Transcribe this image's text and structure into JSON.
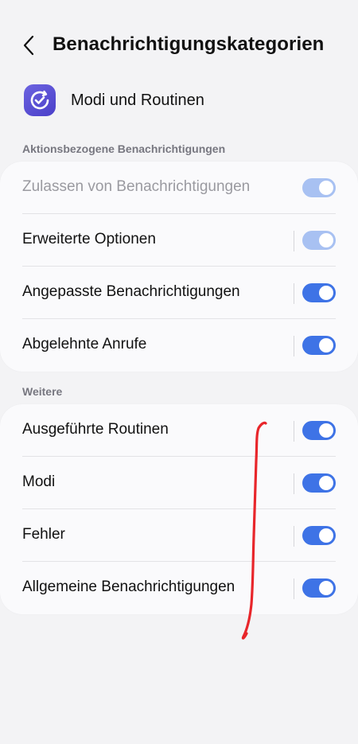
{
  "header": {
    "title": "Benachrichtigungskategorien"
  },
  "app": {
    "name": "Modi und Routinen",
    "icon": "routine-check-icon"
  },
  "sections": [
    {
      "label": "Aktionsbezogene Benachrichtigungen",
      "items": [
        {
          "label": "Zulassen von Benachrichtigungen",
          "enabled": false,
          "toggle_on": true
        },
        {
          "label": "Erweiterte Optionen",
          "enabled": true,
          "toggle_on": true,
          "toggle_dimmed": true
        },
        {
          "label": "Angepasste Benachrichtigungen",
          "enabled": true,
          "toggle_on": true
        },
        {
          "label": "Abgelehnte Anrufe",
          "enabled": true,
          "toggle_on": true
        }
      ]
    },
    {
      "label": "Weitere",
      "items": [
        {
          "label": "Ausgeführte Routinen",
          "enabled": true,
          "toggle_on": true
        },
        {
          "label": "Modi",
          "enabled": true,
          "toggle_on": true
        },
        {
          "label": "Fehler",
          "enabled": true,
          "toggle_on": true
        },
        {
          "label": "Allgemeine Benachrichtigungen",
          "enabled": true,
          "toggle_on": true
        }
      ]
    }
  ],
  "colors": {
    "accent": "#3e73e6",
    "accent_dimmed": "#a8c1f2",
    "annotation_stroke": "#e8262b",
    "background": "#f3f3f5",
    "card": "#fafafc"
  }
}
